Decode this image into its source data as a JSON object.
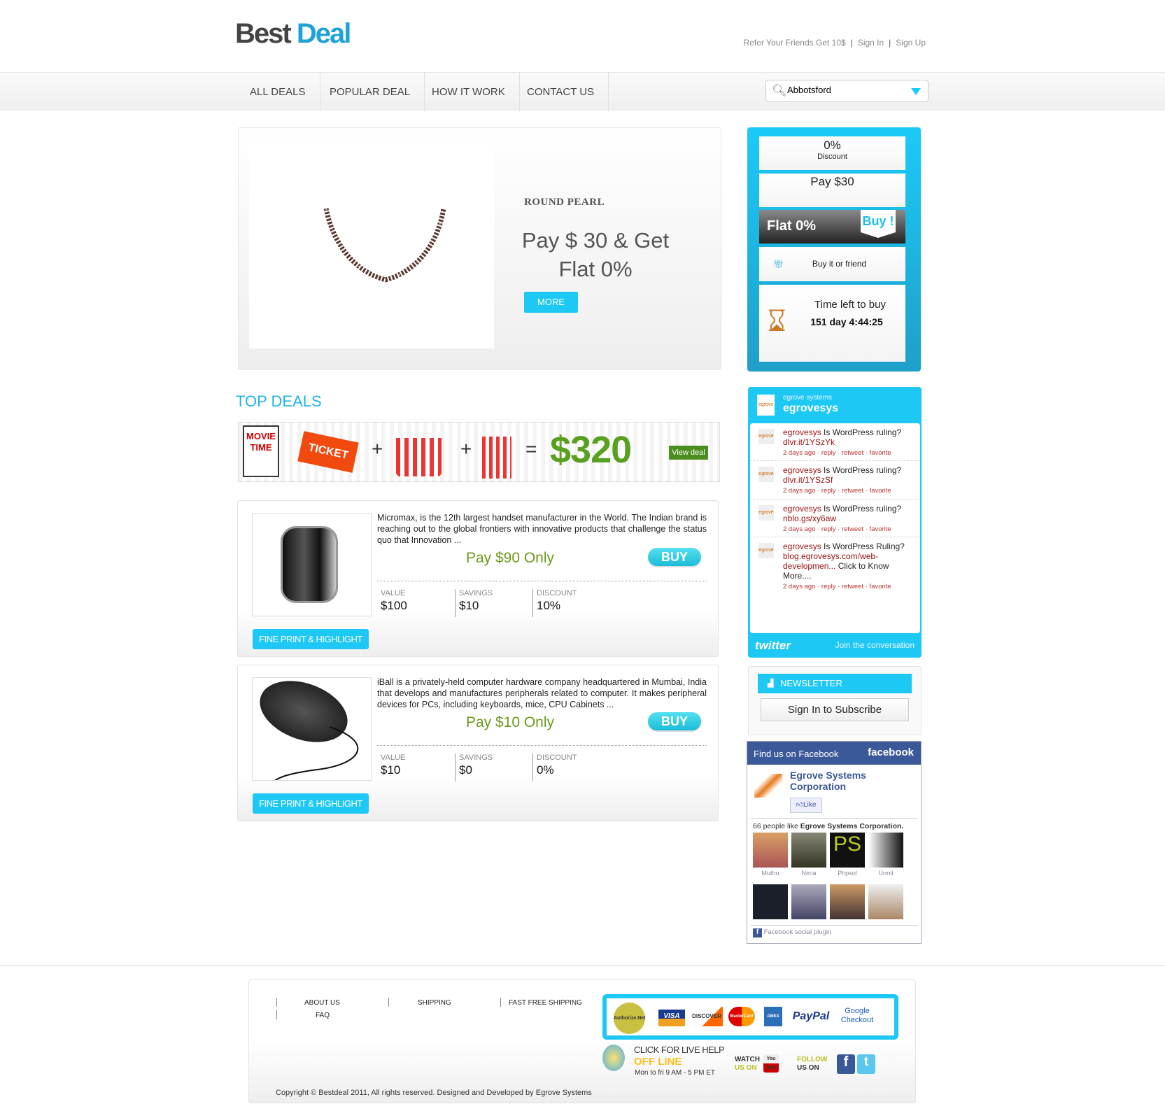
{
  "header": {
    "logo_part1": "Best",
    "logo_part2": "Deal",
    "links": [
      "Refer Your Friends Get 10$",
      "Sign In",
      "Sign Up"
    ]
  },
  "nav": {
    "items": [
      "ALL DEALS",
      "POPULAR DEAL",
      "HOW IT WORK",
      "CONTACT US"
    ],
    "city": "Abbotsford"
  },
  "hero": {
    "name": "ROUND PEARL",
    "offer_line1": "Pay $ 30 & Get",
    "offer_line2": "Flat 0%",
    "more": "MORE"
  },
  "dealbox": {
    "discount": "0%",
    "discount_label": "Discount",
    "pay": "Pay $30",
    "flat": "Flat 0%",
    "buy": "Buy !",
    "gift": "Buy it or friend",
    "time_label": "Time left to buy",
    "time_left": "151 day 4:44:25"
  },
  "top_deals": {
    "title": "TOP DEALS",
    "banner": {
      "movie": "MOVIE TIME",
      "ticket": "TICKET",
      "price": "$320",
      "view": "View deal"
    }
  },
  "products": [
    {
      "desc": "Micromax, is the 12th largest handset manufacturer in the World. The Indian brand is reaching out to the global frontiers with innovative products that challenge the status quo that Innovation ...",
      "price": "Pay $90 Only",
      "buy": "BUY",
      "value_label": "VALUE",
      "value": "$100",
      "savings_label": "SAVINGS",
      "savings": "$10",
      "discount_label": "DISCOUNT",
      "discount": "10%",
      "fine": "FINE PRINT & HIGHLIGHT"
    },
    {
      "desc": "iBall is a privately-held computer hardware company headquartered in Mumbai, India that develops and manufactures peripherals related to computer. It makes peripheral devices for PCs, including keyboards, mice, CPU Cabinets ...",
      "price": "Pay $10 Only",
      "buy": "BUY",
      "value_label": "VALUE",
      "value": "$10",
      "savings_label": "SAVINGS",
      "savings": "$0",
      "discount_label": "DISCOUNT",
      "discount": "0%",
      "fine": "FINE PRINT & HIGHLIGHT"
    }
  ],
  "twitter": {
    "org": "egrove systems",
    "handle": "egrovesys",
    "tweets": [
      {
        "user": "egrovesys",
        "text": " Is WordPress ruling? ",
        "link": "dlvr.it/1YSzYk",
        "meta": "2 days ago · reply · retweet · favorite"
      },
      {
        "user": "egrovesys",
        "text": " Is WordPress ruling? ",
        "link": "dlvr.it/1YSzSf",
        "meta": "2 days ago · reply · retweet · favorite"
      },
      {
        "user": "egrovesys",
        "text": " Is WordPress ruling? ",
        "link": "nblo.gs/xy6aw",
        "meta": "2 days ago · reply · retweet · favorite"
      },
      {
        "user": "egrovesys",
        "text": " Is WordPress Ruling? ",
        "link": "blog.egrovesys.com/web-developmen...",
        "tail": " Click to Know More....",
        "meta": "2 days ago · reply · retweet · favorite"
      }
    ],
    "logo": "twitter",
    "join": "Join the conversation"
  },
  "newsletter": {
    "title": "NEWSLETTER",
    "button": "Sign In to Subscribe"
  },
  "facebook": {
    "find": "Find us on Facebook",
    "brand": "facebook",
    "page": "Egrove Systems Corporation",
    "like": "Like",
    "count_text": "66 people like ",
    "count_page": "Egrove Systems Corporation.",
    "fans": [
      "Muthu",
      "Nima",
      "Phpsol",
      "Urmil"
    ],
    "plugin": "Facebook social plugin"
  },
  "footer": {
    "links": [
      "ABOUT US",
      "SHIPPING",
      "FAST FREE SHIPPING",
      "FAQ"
    ],
    "cards": [
      "Authorize.Net",
      "VISA",
      "DISCOVER",
      "MasterCard",
      "AMEX",
      "PayPal",
      "Google Checkout"
    ],
    "live_help": "CLICK FOR LIVE HELP",
    "status": "OFF LINE",
    "hours": "Mon to fri 9 AM - 5 PM ET",
    "watch": "WATCH",
    "watch_on": "US ON",
    "youtube": "You Tube",
    "follow": "FOLLOW",
    "follow_on": "US ON",
    "copyright": "Copyright © Bestdeal 2011, All rights reserved. Designed and Developed by Egrove Systems"
  }
}
